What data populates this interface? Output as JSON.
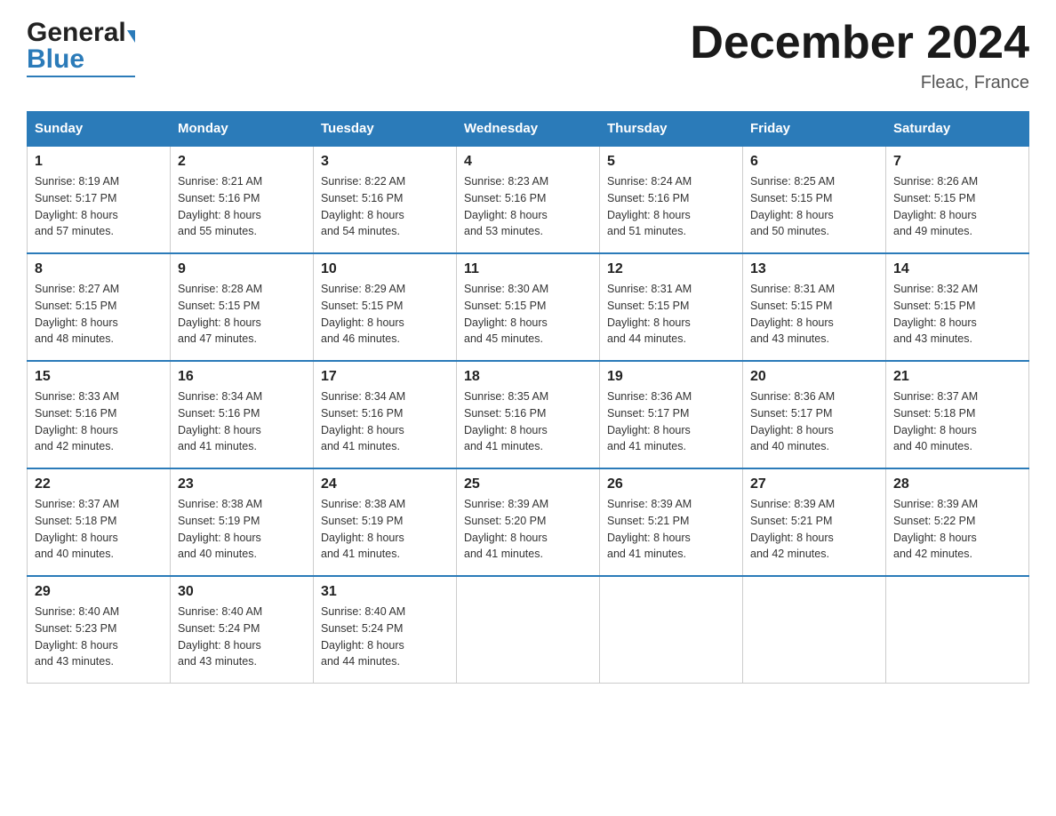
{
  "header": {
    "logo_general": "General",
    "logo_blue": "Blue",
    "title": "December 2024",
    "location": "Fleac, France"
  },
  "calendar": {
    "days_of_week": [
      "Sunday",
      "Monday",
      "Tuesday",
      "Wednesday",
      "Thursday",
      "Friday",
      "Saturday"
    ],
    "weeks": [
      [
        {
          "day": "1",
          "sunrise": "8:19 AM",
          "sunset": "5:17 PM",
          "daylight": "8 hours and 57 minutes."
        },
        {
          "day": "2",
          "sunrise": "8:21 AM",
          "sunset": "5:16 PM",
          "daylight": "8 hours and 55 minutes."
        },
        {
          "day": "3",
          "sunrise": "8:22 AM",
          "sunset": "5:16 PM",
          "daylight": "8 hours and 54 minutes."
        },
        {
          "day": "4",
          "sunrise": "8:23 AM",
          "sunset": "5:16 PM",
          "daylight": "8 hours and 53 minutes."
        },
        {
          "day": "5",
          "sunrise": "8:24 AM",
          "sunset": "5:16 PM",
          "daylight": "8 hours and 51 minutes."
        },
        {
          "day": "6",
          "sunrise": "8:25 AM",
          "sunset": "5:15 PM",
          "daylight": "8 hours and 50 minutes."
        },
        {
          "day": "7",
          "sunrise": "8:26 AM",
          "sunset": "5:15 PM",
          "daylight": "8 hours and 49 minutes."
        }
      ],
      [
        {
          "day": "8",
          "sunrise": "8:27 AM",
          "sunset": "5:15 PM",
          "daylight": "8 hours and 48 minutes."
        },
        {
          "day": "9",
          "sunrise": "8:28 AM",
          "sunset": "5:15 PM",
          "daylight": "8 hours and 47 minutes."
        },
        {
          "day": "10",
          "sunrise": "8:29 AM",
          "sunset": "5:15 PM",
          "daylight": "8 hours and 46 minutes."
        },
        {
          "day": "11",
          "sunrise": "8:30 AM",
          "sunset": "5:15 PM",
          "daylight": "8 hours and 45 minutes."
        },
        {
          "day": "12",
          "sunrise": "8:31 AM",
          "sunset": "5:15 PM",
          "daylight": "8 hours and 44 minutes."
        },
        {
          "day": "13",
          "sunrise": "8:31 AM",
          "sunset": "5:15 PM",
          "daylight": "8 hours and 43 minutes."
        },
        {
          "day": "14",
          "sunrise": "8:32 AM",
          "sunset": "5:15 PM",
          "daylight": "8 hours and 43 minutes."
        }
      ],
      [
        {
          "day": "15",
          "sunrise": "8:33 AM",
          "sunset": "5:16 PM",
          "daylight": "8 hours and 42 minutes."
        },
        {
          "day": "16",
          "sunrise": "8:34 AM",
          "sunset": "5:16 PM",
          "daylight": "8 hours and 41 minutes."
        },
        {
          "day": "17",
          "sunrise": "8:34 AM",
          "sunset": "5:16 PM",
          "daylight": "8 hours and 41 minutes."
        },
        {
          "day": "18",
          "sunrise": "8:35 AM",
          "sunset": "5:16 PM",
          "daylight": "8 hours and 41 minutes."
        },
        {
          "day": "19",
          "sunrise": "8:36 AM",
          "sunset": "5:17 PM",
          "daylight": "8 hours and 41 minutes."
        },
        {
          "day": "20",
          "sunrise": "8:36 AM",
          "sunset": "5:17 PM",
          "daylight": "8 hours and 40 minutes."
        },
        {
          "day": "21",
          "sunrise": "8:37 AM",
          "sunset": "5:18 PM",
          "daylight": "8 hours and 40 minutes."
        }
      ],
      [
        {
          "day": "22",
          "sunrise": "8:37 AM",
          "sunset": "5:18 PM",
          "daylight": "8 hours and 40 minutes."
        },
        {
          "day": "23",
          "sunrise": "8:38 AM",
          "sunset": "5:19 PM",
          "daylight": "8 hours and 40 minutes."
        },
        {
          "day": "24",
          "sunrise": "8:38 AM",
          "sunset": "5:19 PM",
          "daylight": "8 hours and 41 minutes."
        },
        {
          "day": "25",
          "sunrise": "8:39 AM",
          "sunset": "5:20 PM",
          "daylight": "8 hours and 41 minutes."
        },
        {
          "day": "26",
          "sunrise": "8:39 AM",
          "sunset": "5:21 PM",
          "daylight": "8 hours and 41 minutes."
        },
        {
          "day": "27",
          "sunrise": "8:39 AM",
          "sunset": "5:21 PM",
          "daylight": "8 hours and 42 minutes."
        },
        {
          "day": "28",
          "sunrise": "8:39 AM",
          "sunset": "5:22 PM",
          "daylight": "8 hours and 42 minutes."
        }
      ],
      [
        {
          "day": "29",
          "sunrise": "8:40 AM",
          "sunset": "5:23 PM",
          "daylight": "8 hours and 43 minutes."
        },
        {
          "day": "30",
          "sunrise": "8:40 AM",
          "sunset": "5:24 PM",
          "daylight": "8 hours and 43 minutes."
        },
        {
          "day": "31",
          "sunrise": "8:40 AM",
          "sunset": "5:24 PM",
          "daylight": "8 hours and 44 minutes."
        },
        null,
        null,
        null,
        null
      ]
    ],
    "labels": {
      "sunrise": "Sunrise:",
      "sunset": "Sunset:",
      "daylight": "Daylight:"
    }
  }
}
